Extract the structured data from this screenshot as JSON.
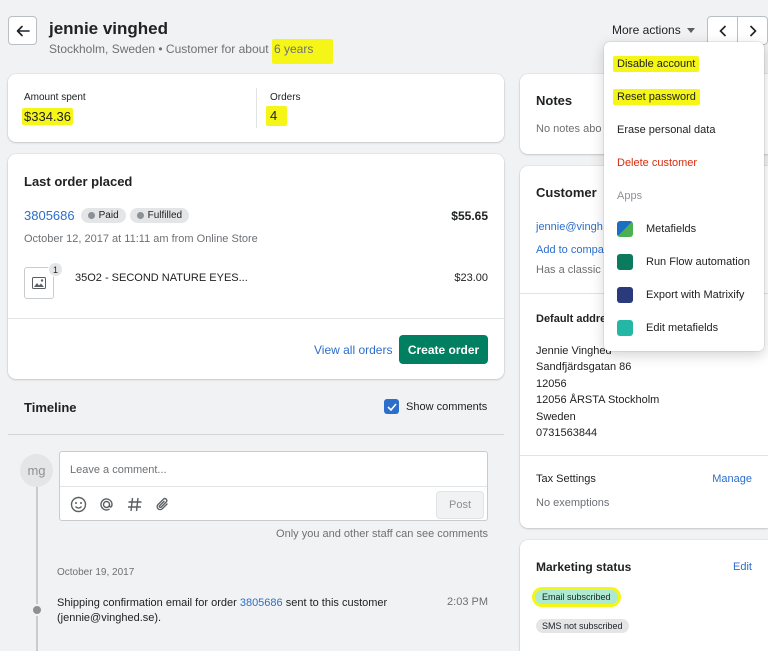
{
  "header": {
    "customer_name": "jennie vinghed",
    "subtitle_prefix": "Stockholm, Sweden • Customer for about",
    "subtitle_duration": "6 years",
    "more_actions_label": "More actions"
  },
  "stats": {
    "amount_label": "Amount spent",
    "amount_value": "$334.36",
    "orders_label": "Orders",
    "orders_value": "4"
  },
  "last_order": {
    "title": "Last order placed",
    "order_number": "3805686",
    "paid_badge": "Paid",
    "fulfilled_badge": "Fulfilled",
    "total": "$55.65",
    "date_line": "October 12, 2017 at 11:11 am from Online Store",
    "item_quantity": "1",
    "item_name": "35O2 - SECOND NATURE EYES...",
    "item_price": "$23.00",
    "view_all_label": "View all orders",
    "create_order_label": "Create order"
  },
  "timeline": {
    "title": "Timeline",
    "show_comments_label": "Show comments",
    "avatar_initials": "mg",
    "comment_placeholder": "Leave a comment...",
    "post_label": "Post",
    "visibility_note": "Only you and other staff can see comments",
    "event_date": "October 19, 2017",
    "event_text_prefix": "Shipping confirmation email for order",
    "event_order_link": "3805686",
    "event_text_suffix": "sent to this customer",
    "event_email": "(jennie@vinghed.se).",
    "event_time": "2:03 PM"
  },
  "notes": {
    "title": "Notes",
    "empty_text": "No notes abo"
  },
  "customer": {
    "title": "Customer",
    "email": "jennie@vingh",
    "add_company": "Add to compa",
    "account_text": "Has a classic a"
  },
  "default_address": {
    "title": "Default addre",
    "lines": [
      "Jennie Vinghed",
      "Sandfjärdsgatan 86",
      "12056",
      "12056 ÅRSTA Stockholm",
      "Sweden",
      "0731563844"
    ]
  },
  "tax": {
    "title": "Tax Settings",
    "manage_label": "Manage",
    "value": "No exemptions"
  },
  "marketing": {
    "title": "Marketing status",
    "edit_label": "Edit",
    "email_status": "Email subscribed",
    "sms_status": "SMS not subscribed"
  },
  "dropdown": {
    "disable_account": "Disable account",
    "reset_password": "Reset password",
    "erase_data": "Erase personal data",
    "delete_customer": "Delete customer",
    "apps_header": "Apps",
    "apps": [
      {
        "label": "Metafields",
        "icon": "metafields-icon"
      },
      {
        "label": "Run Flow automation",
        "icon": "flow-icon"
      },
      {
        "label": "Export with Matrixify",
        "icon": "matrixify-icon"
      },
      {
        "label": "Edit metafields",
        "icon": "edit-metafields-icon"
      }
    ]
  },
  "colors": {
    "highlight": "#f5f518",
    "primary_button": "#008060",
    "link": "#2c6ecb",
    "critical": "#d72c0d"
  }
}
